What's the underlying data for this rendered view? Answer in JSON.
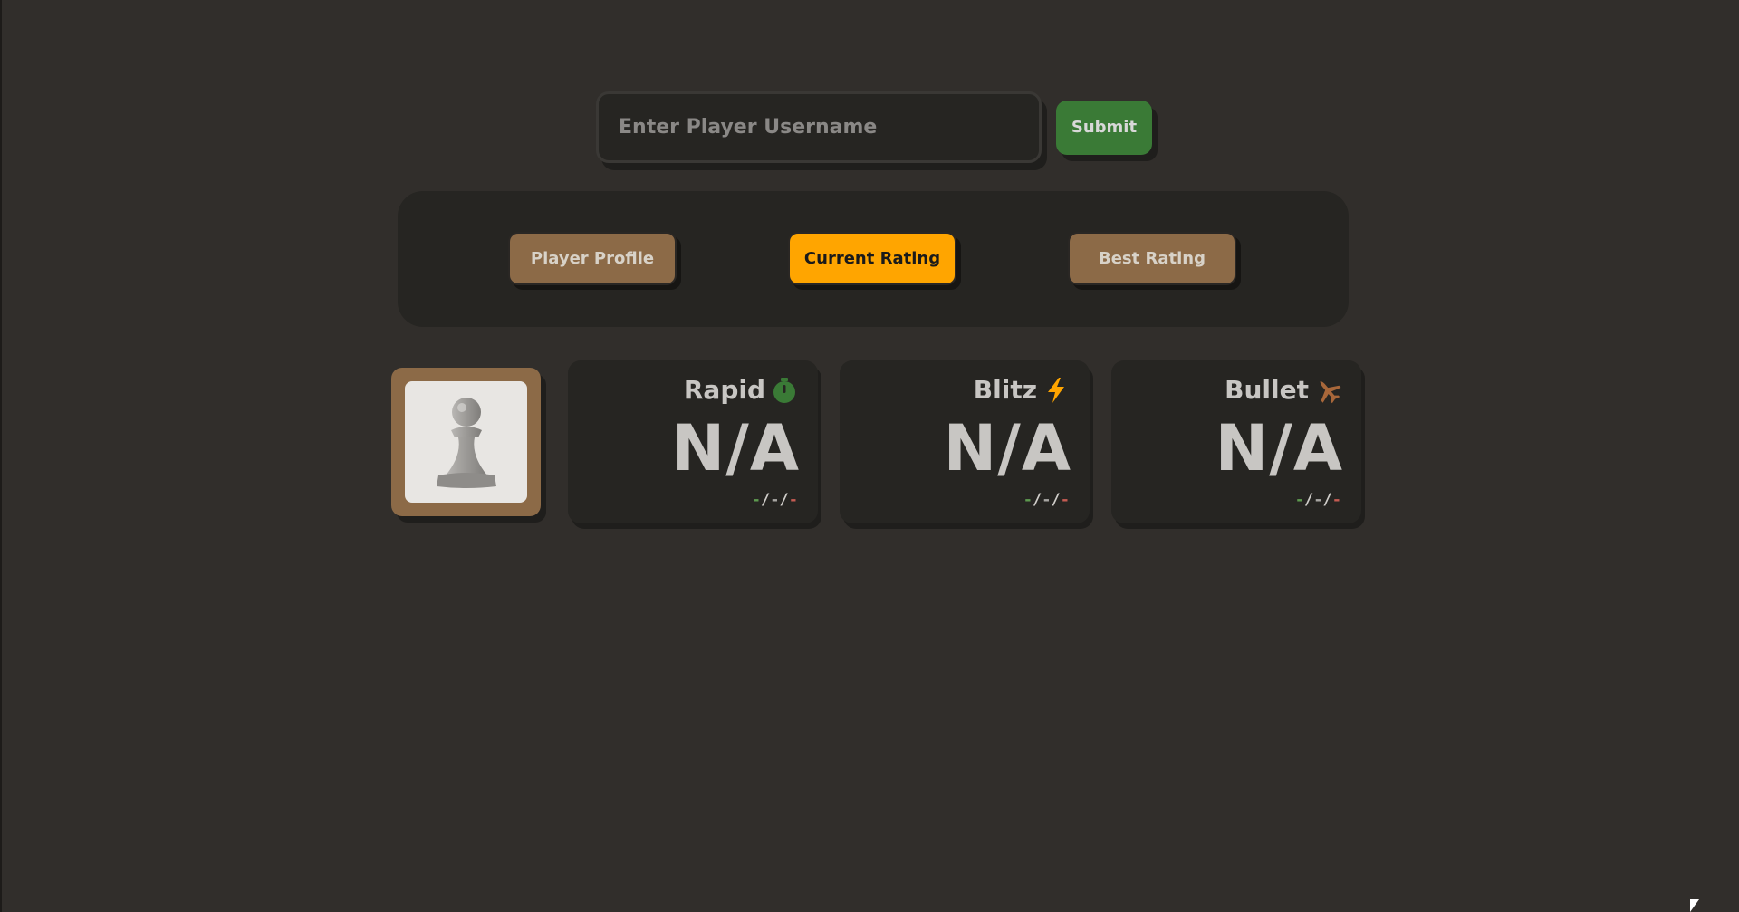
{
  "search": {
    "placeholder": "Enter Player Username",
    "value": "",
    "submit_label": "Submit"
  },
  "tabs": [
    {
      "label": "Player Profile",
      "active": false
    },
    {
      "label": "Current Rating",
      "active": true
    },
    {
      "label": "Best Rating",
      "active": false
    }
  ],
  "avatar": {
    "icon": "pawn-icon"
  },
  "ratings": [
    {
      "title": "Rapid",
      "icon": "stopwatch-icon",
      "icon_color": "#3a7a36",
      "value": "N/A",
      "record": {
        "win": "-",
        "draw": "-",
        "loss": "-",
        "sep": "/"
      }
    },
    {
      "title": "Blitz",
      "icon": "lightning-icon",
      "icon_color": "#ffa500",
      "value": "N/A",
      "record": {
        "win": "-",
        "draw": "-",
        "loss": "-",
        "sep": "/"
      }
    },
    {
      "title": "Bullet",
      "icon": "jet-icon",
      "icon_color": "#a8673a",
      "value": "N/A",
      "record": {
        "win": "-",
        "draw": "-",
        "loss": "-",
        "sep": "/"
      }
    }
  ],
  "colors": {
    "background": "#312e2b",
    "panel": "#262522",
    "submit": "#3a7a36",
    "tab_inactive": "#8c6a47",
    "tab_active": "#ffa500"
  }
}
